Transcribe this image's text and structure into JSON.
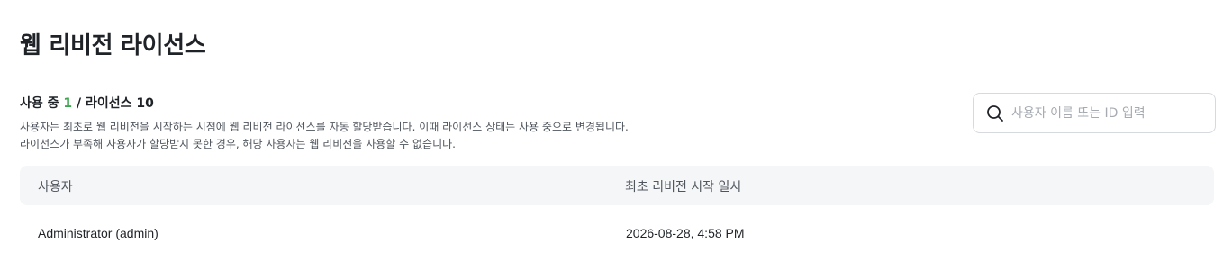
{
  "page": {
    "title": "웹 리비전 라이선스"
  },
  "usage": {
    "used_label": "사용 중",
    "used_count": "1",
    "separator": "/",
    "license_label": "라이선스",
    "license_count": "10"
  },
  "description": {
    "line1": "사용자는 최초로 웹 리비전을 시작하는 시점에 웹 리비전 라이선스를 자동 할당받습니다. 이때 라이선스 상태는 사용 중으로 변경됩니다.",
    "line2": "라이선스가 부족해 사용자가 할당받지 못한 경우, 해당 사용자는 웹 리비전을 사용할 수 없습니다."
  },
  "search": {
    "placeholder": "사용자 이름 또는 ID 입력",
    "value": "",
    "icon": "search-icon"
  },
  "table": {
    "columns": [
      "사용자",
      "최초 리비전 시작 일시"
    ],
    "rows": [
      [
        "Administrator (admin)",
        "2026-08-28, 4:58 PM"
      ]
    ]
  }
}
